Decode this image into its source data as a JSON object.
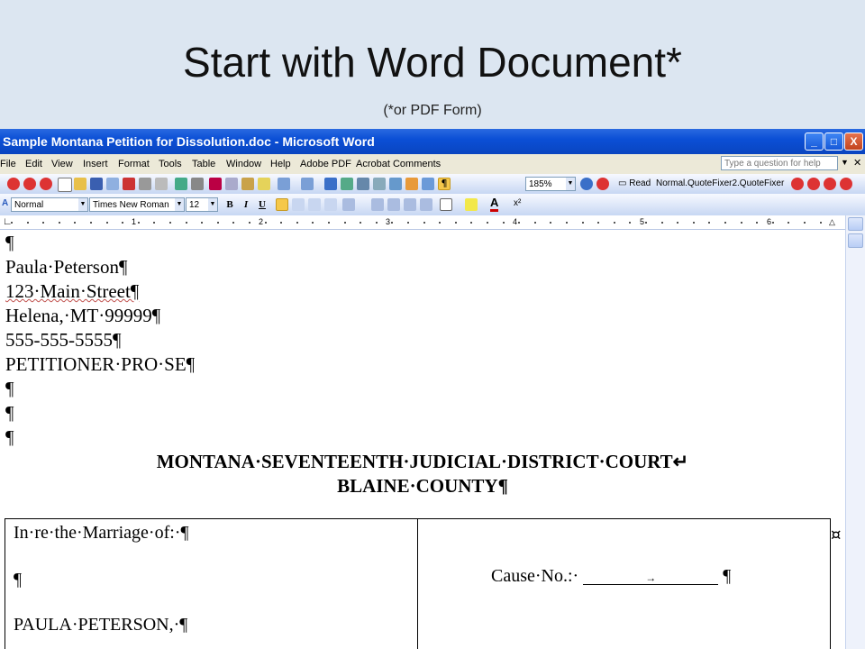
{
  "slide": {
    "title": "Start with Word Document*",
    "subtitle": "(*or PDF Form)"
  },
  "window": {
    "title": "Sample Montana Petition for Dissolution.doc - Microsoft Word",
    "minimize": "_",
    "maximize": "□",
    "close": "X"
  },
  "menu": {
    "items": [
      "File",
      "Edit",
      "View",
      "Insert",
      "Format",
      "Tools",
      "Table",
      "Window",
      "Help",
      "Adobe PDF",
      "Acrobat Comments"
    ],
    "ask_placeholder": "Type a question for help"
  },
  "toolbar": {
    "zoom": "185%",
    "read_label": "Read",
    "macro_label": "Normal.QuoteFixer2.QuoteFixer",
    "style": "Normal",
    "font": "Times New Roman",
    "size": "12",
    "bold": "B",
    "italic": "I",
    "underline": "U"
  },
  "ruler": {
    "numbers": [
      "1",
      "2",
      "3",
      "4",
      "5",
      "6"
    ]
  },
  "document": {
    "lines": [
      "¶",
      "Paula·Peterson¶",
      "123·Main·Street¶",
      "Helena,·MT·99999¶",
      "555-555-5555¶",
      "PETITIONER·PRO·SE¶",
      "¶",
      "¶",
      "¶"
    ],
    "court_line1": "MONTANA·SEVENTEENTH·JUDICIAL·DISTRICT·COURT↵",
    "court_line2": "BLAINE·COUNTY¶",
    "table": {
      "left": [
        "In·re·the·Marriage·of:·¶",
        "¶",
        "PAULA·PETERSON,·¶"
      ],
      "cause_label": "Cause·No.:·",
      "cause_arrow": "→",
      "cause_end": "¶",
      "cell_mark": "¤"
    }
  },
  "colors": {
    "slide_bg": "#dce6f1",
    "titlebar": "#0b4fd6",
    "menubar": "#ece9d8",
    "toolbar": "#c7d7f3"
  }
}
